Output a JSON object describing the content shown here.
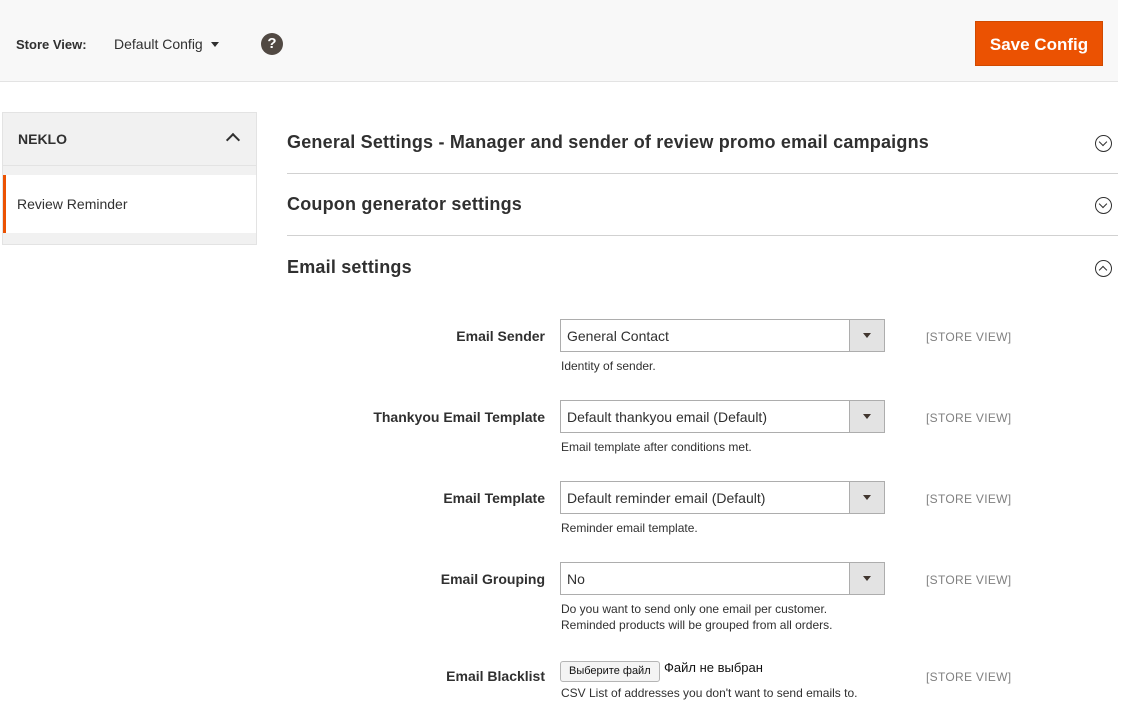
{
  "header": {
    "store_view_label": "Store View:",
    "store_view_value": "Default Config",
    "help_glyph": "?",
    "save_label": "Save Config"
  },
  "sidebar": {
    "group_title": "NEKLO",
    "items": [
      {
        "label": "Review Reminder",
        "active": true
      }
    ]
  },
  "sections": [
    {
      "title": "General Settings - Manager and sender of review promo email campaigns",
      "expanded": false
    },
    {
      "title": "Coupon generator settings",
      "expanded": false
    },
    {
      "title": "Email settings",
      "expanded": true
    }
  ],
  "fields": [
    {
      "label": "Email Sender",
      "value": "General Contact",
      "note": [
        "Identity of sender."
      ],
      "scope": "[STORE VIEW]"
    },
    {
      "label": "Thankyou Email Template",
      "value": "Default thankyou email (Default)",
      "note": [
        "Email template after conditions met."
      ],
      "scope": "[STORE VIEW]"
    },
    {
      "label": "Email Template",
      "value": "Default reminder email (Default)",
      "note": [
        "Reminder email template."
      ],
      "scope": "[STORE VIEW]"
    },
    {
      "label": "Email Grouping",
      "value": "No",
      "note": [
        "Do you want to send only one email per customer.",
        "Reminded products will be grouped from all orders."
      ],
      "scope": "[STORE VIEW]"
    }
  ],
  "blacklist": {
    "label": "Email Blacklist",
    "button_label": "Выберите файл",
    "file_status": "Файл не выбран",
    "note": "CSV List of addresses you don't want to send emails to.",
    "scope": "[STORE VIEW]"
  },
  "colors": {
    "accent": "#eb5202",
    "text": "#303030",
    "muted": "#808080"
  }
}
